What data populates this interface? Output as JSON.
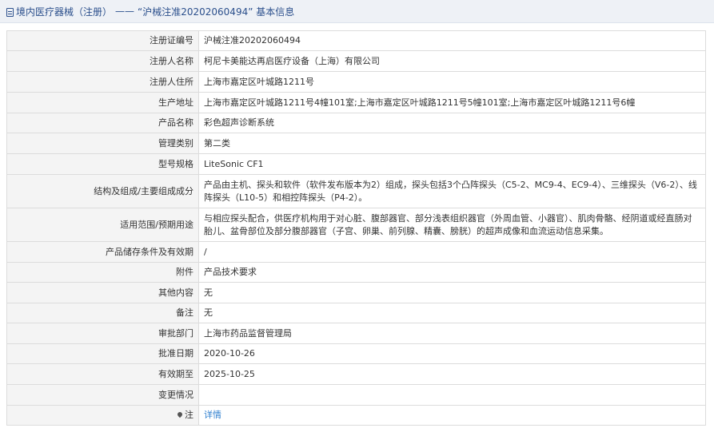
{
  "header": {
    "category": "境内医疗器械（注册）",
    "separator": "——",
    "record_title": "“沪械注准20202060494” 基本信息"
  },
  "rows": [
    {
      "label": "注册证编号",
      "value": "沪械注准20202060494"
    },
    {
      "label": "注册人名称",
      "value": "柯尼卡美能达再启医疗设备（上海）有限公司"
    },
    {
      "label": "注册人住所",
      "value": "上海市嘉定区叶城路1211号"
    },
    {
      "label": "生产地址",
      "value": "上海市嘉定区叶城路1211号4幢101室;上海市嘉定区叶城路1211号5幢101室;上海市嘉定区叶城路1211号6幢"
    },
    {
      "label": "产品名称",
      "value": "彩色超声诊断系统"
    },
    {
      "label": "管理类别",
      "value": "第二类"
    },
    {
      "label": "型号规格",
      "value": "LiteSonic CF1"
    },
    {
      "label": "结构及组成/主要组成成分",
      "value": "产品由主机、探头和软件（软件发布版本为2）组成，探头包括3个凸阵探头（C5-2、MC9-4、EC9-4）、三维探头（V6-2）、线阵探头（L10-5）和相控阵探头（P4-2）。"
    },
    {
      "label": "适用范围/预期用途",
      "value": "与相应探头配合，供医疗机构用于对心脏、腹部器官、部分浅表组织器官（外周血管、小器官）、肌肉骨骼、经阴道或经直肠对胎儿、盆骨部位及部分腹部器官（子宫、卵巢、前列腺、精囊、膀胱）的超声成像和血流运动信息采集。"
    },
    {
      "label": "产品储存条件及有效期",
      "value": "/"
    },
    {
      "label": "附件",
      "value": "产品技术要求"
    },
    {
      "label": "其他内容",
      "value": "无"
    },
    {
      "label": "备注",
      "value": "无"
    },
    {
      "label": "审批部门",
      "value": "上海市药品监督管理局"
    },
    {
      "label": "批准日期",
      "value": "2020-10-26"
    },
    {
      "label": "有效期至",
      "value": "2025-10-25"
    },
    {
      "label": "变更情况",
      "value": ""
    }
  ],
  "note_row": {
    "label": "注",
    "icon": "pin-icon",
    "link_text": "详情"
  },
  "colors": {
    "header_bg": "#eef1f6",
    "header_text": "#2b4f8c",
    "label_bg": "#f4f4f4",
    "link": "#2f7fcf"
  }
}
